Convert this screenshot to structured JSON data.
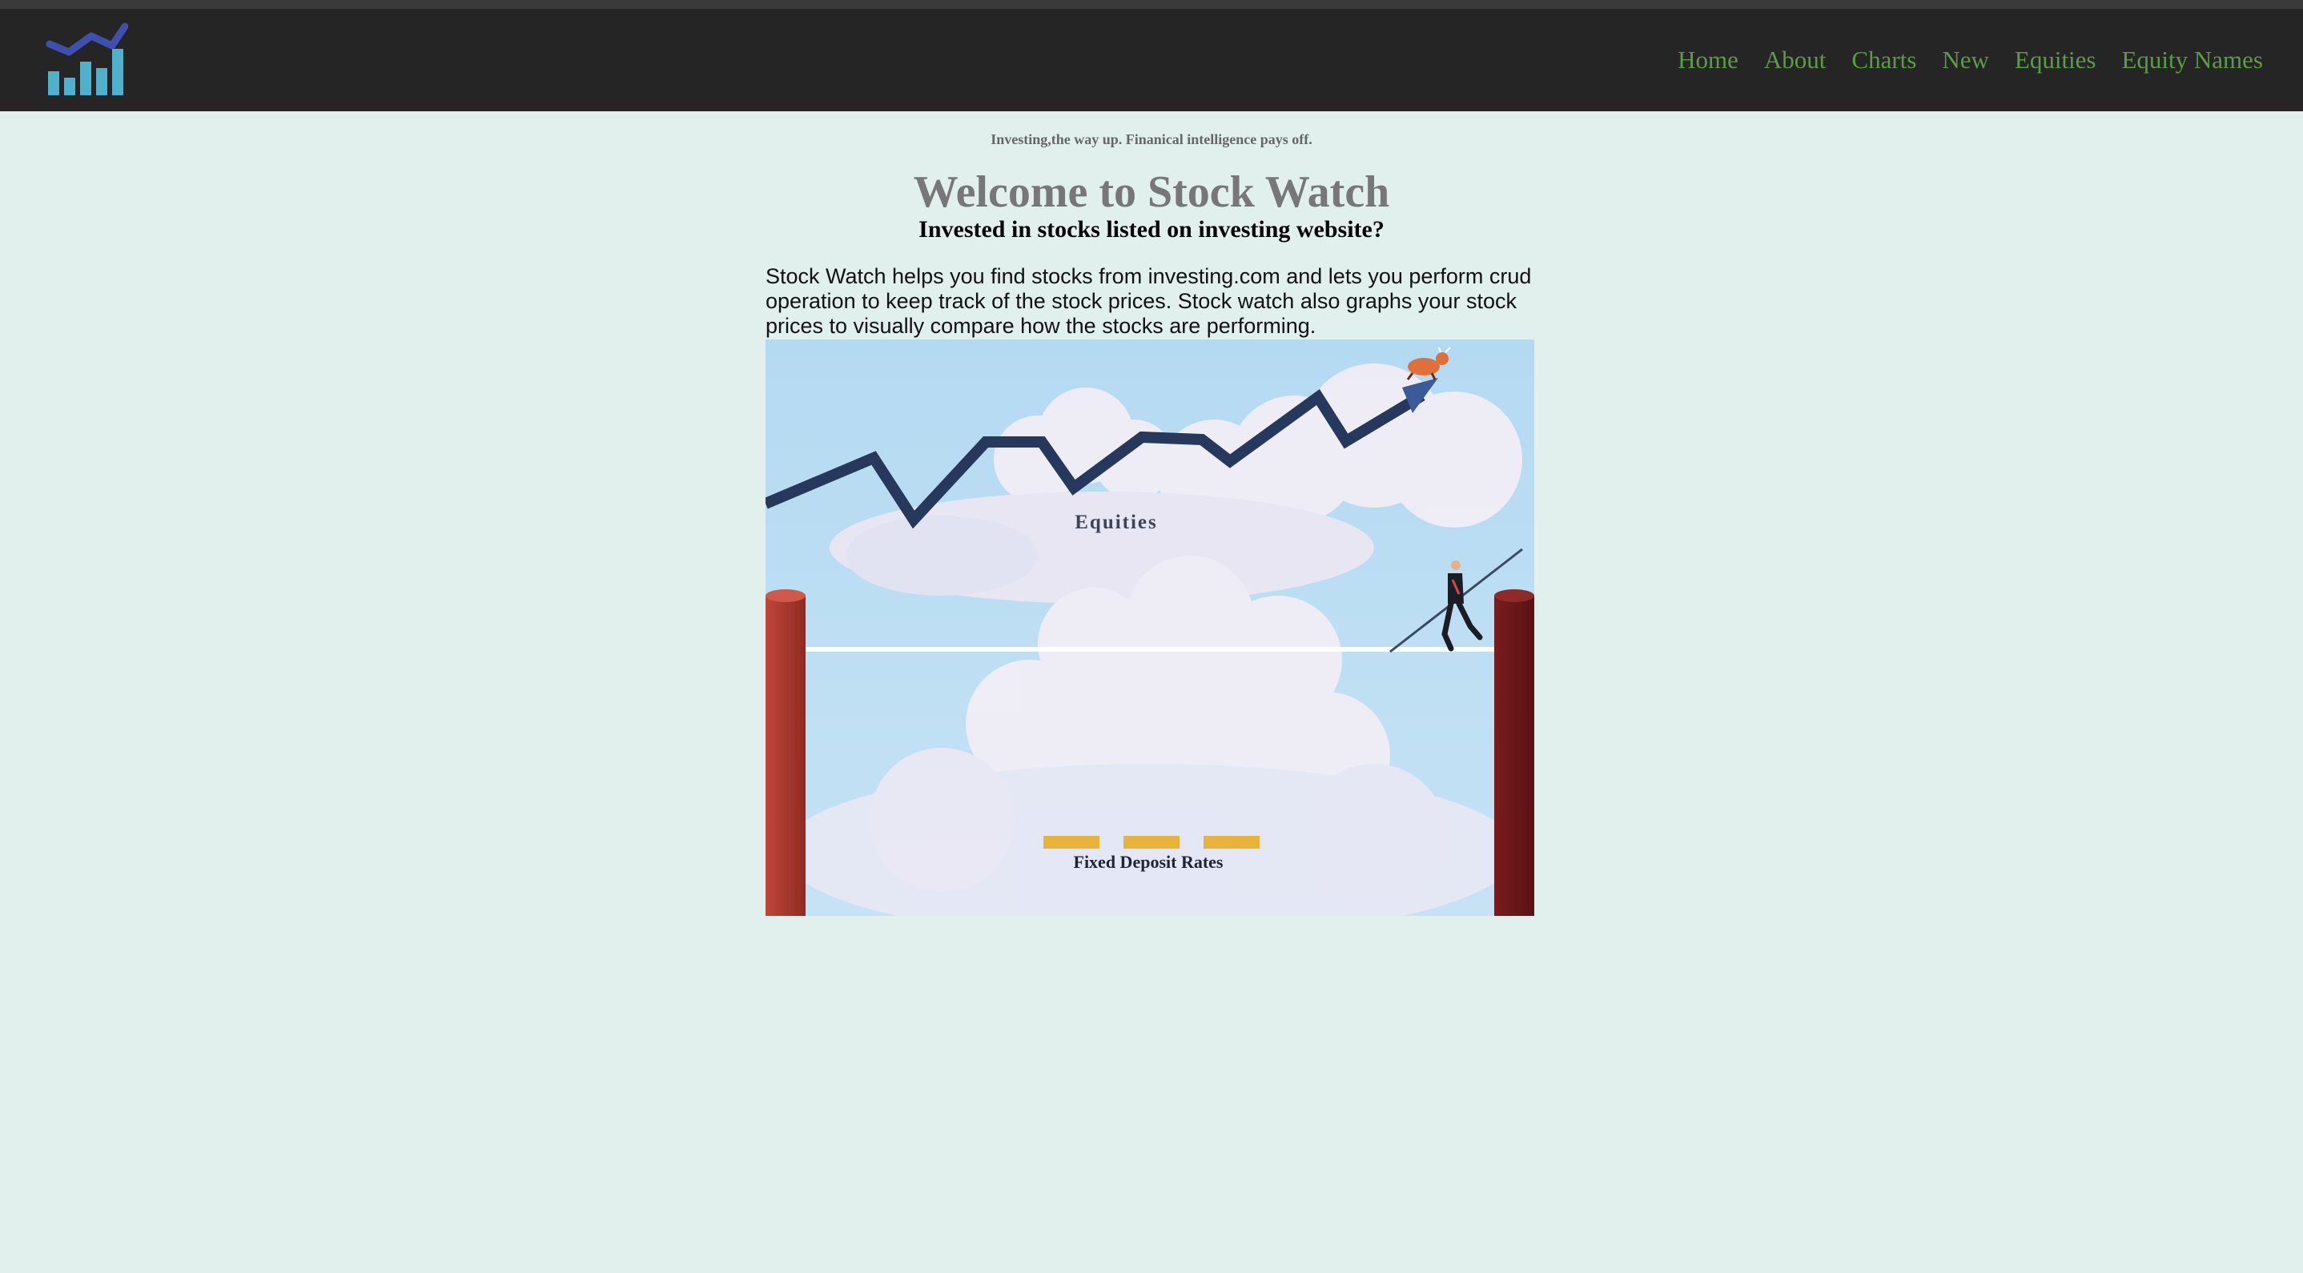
{
  "nav": {
    "items": [
      "Home",
      "About",
      "Charts",
      "New",
      "Equities",
      "Equity Names"
    ]
  },
  "logo": {
    "icon": "bar-chart-trend-icon"
  },
  "tagline": "Investing,the way up. Finanical intelligence pays off.",
  "title": "Welcome to Stock Watch",
  "subtitle": "Invested in stocks listed on investing website?",
  "description": "Stock Watch helps you find stocks from investing.com and lets you perform crud operation to keep track of the stock prices. Stock watch also graphs your stock prices to visually compare how the stocks are performing.",
  "hero": {
    "label_top": "Equities",
    "label_bottom": "Fixed Deposit Rates"
  },
  "colors": {
    "header_bg": "#252525",
    "nav_link": "#5a9e44",
    "page_bg": "#e1f0ec",
    "title": "#777777"
  }
}
